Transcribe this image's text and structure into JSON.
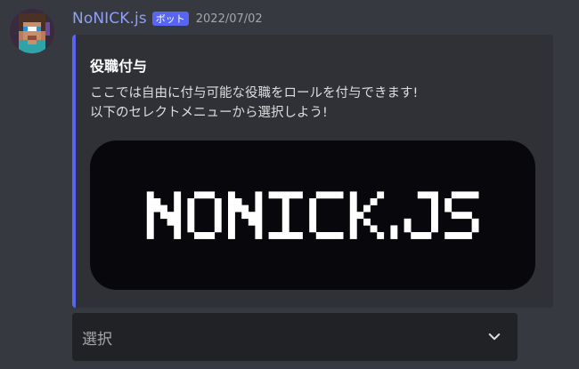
{
  "message": {
    "author": {
      "username": "NoNICK.js",
      "bot_tag": "ボット",
      "avatar_icon": "minecraft-skin-avatar"
    },
    "timestamp": "2022/07/02",
    "embed": {
      "title": "役職付与",
      "description_lines": [
        "ここでは自由に付与可能な役職をロールを付与できます!",
        "以下のセレクトメニューから選択しよう!"
      ],
      "accent_color": "#5865f2",
      "image": {
        "text": "NONICK.JS",
        "background": "#08080c",
        "text_color": "#ffffff"
      }
    },
    "select_menu": {
      "placeholder": "選択",
      "icon": "chevron-down-icon"
    }
  },
  "colors": {
    "background": "#36393f",
    "embed_background": "#2f3136",
    "select_background": "#202225",
    "username": "#919ff7",
    "bot_tag": "#5865f2"
  }
}
